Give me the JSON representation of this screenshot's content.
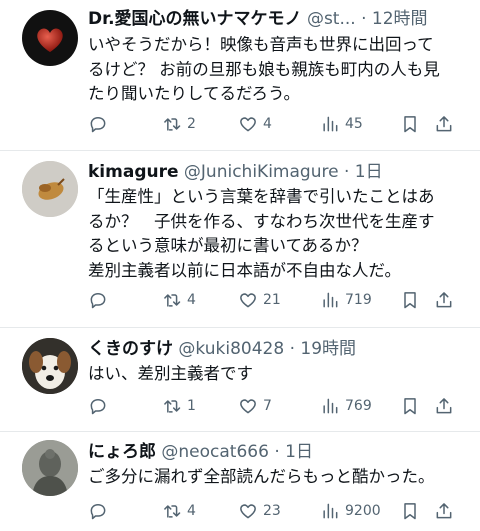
{
  "tweets": [
    {
      "name": "Dr.愛国心の無いナマケモノ",
      "handle": "@st...",
      "time": "12時間",
      "text": [
        "いやそうだから！映像も音声も世界に出回って",
        "るけど？ お前の旦那も娘も親族も町内の人も見",
        "たり聞いたりしてるだろう。"
      ],
      "reply_count": "",
      "retweet_count": "2",
      "like_count": "4",
      "view_count": "45"
    },
    {
      "name": "kimagure",
      "handle": "@JunichiKimagure",
      "time": "1日",
      "text": [
        "「生産性」という言葉を辞書で引いたことはあ",
        "るか？　子供を作る、すなわち次世代を生産す",
        "るという意味が最初に書いてあるか？",
        "差別主義者以前に日本語が不自由な人だ。"
      ],
      "reply_count": "",
      "retweet_count": "4",
      "like_count": "21",
      "view_count": "719"
    },
    {
      "name": "くきのすけ",
      "handle": "@kuki80428",
      "time": "19時間",
      "text": [
        "はい、差別主義者です"
      ],
      "reply_count": "",
      "retweet_count": "1",
      "like_count": "7",
      "view_count": "769"
    },
    {
      "name": "にょろ郎",
      "handle": "@neocat666",
      "time": "1日",
      "text": [
        "ご多分に漏れず全部読んだらもっと酷かった。"
      ],
      "reply_count": "",
      "retweet_count": "4",
      "like_count": "23",
      "view_count": "9200"
    }
  ],
  "separator": "·",
  "icons": {
    "avatar_0": "red-heart-avatar",
    "avatar_1": "fried-food-avatar",
    "avatar_2": "dog-avatar",
    "avatar_3": "buddha-statue-avatar",
    "reply": "reply-icon",
    "retweet": "retweet-icon",
    "like": "heart-icon",
    "views": "views-icon",
    "bookmark": "bookmark-icon",
    "share": "share-icon"
  },
  "colors": {
    "text": "#0f1419",
    "secondary": "#536471",
    "divider": "#e6e9eb"
  }
}
